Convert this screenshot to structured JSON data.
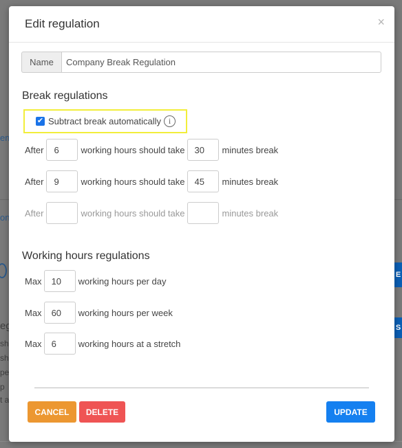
{
  "background": {
    "frag_1": "em",
    "frag_2": "on",
    "frag_3": "eg",
    "frag_4": "sh",
    "frag_5": "sh",
    "frag_6": "pe",
    "frag_7": "p",
    "frag_8": "t a",
    "blue_1": "E",
    "blue_2": "S"
  },
  "modal": {
    "title": "Edit regulation",
    "close": "×"
  },
  "name_field": {
    "label": "Name",
    "value": "Company Break Regulation"
  },
  "break_section": {
    "title": "Break regulations",
    "subtract_label": "Subtract break automatically",
    "info_glyph": "i",
    "rows": [
      {
        "after": "After",
        "hours": "6",
        "middle": "working hours should take",
        "minutes": "30",
        "end": "minutes break"
      },
      {
        "after": "After",
        "hours": "9",
        "middle": "working hours should take",
        "minutes": "45",
        "end": "minutes break"
      },
      {
        "after": "After",
        "hours": "",
        "middle": "working hours should take",
        "minutes": "",
        "end": "minutes break"
      }
    ]
  },
  "working_section": {
    "title": "Working hours regulations",
    "rows": [
      {
        "prefix": "Max",
        "value": "10",
        "suffix": "working hours per day"
      },
      {
        "prefix": "Max",
        "value": "60",
        "suffix": "working hours per week"
      },
      {
        "prefix": "Max",
        "value": "6",
        "suffix": "working hours at a stretch"
      }
    ]
  },
  "buttons": {
    "cancel": "CANCEL",
    "delete": "DELETE",
    "update": "UPDATE"
  },
  "colors": {
    "cancel": "#ec9731",
    "delete": "#ef5454",
    "update": "#1580f0",
    "highlight": "#f2ee3a",
    "checkbox": "#1a73e8"
  }
}
